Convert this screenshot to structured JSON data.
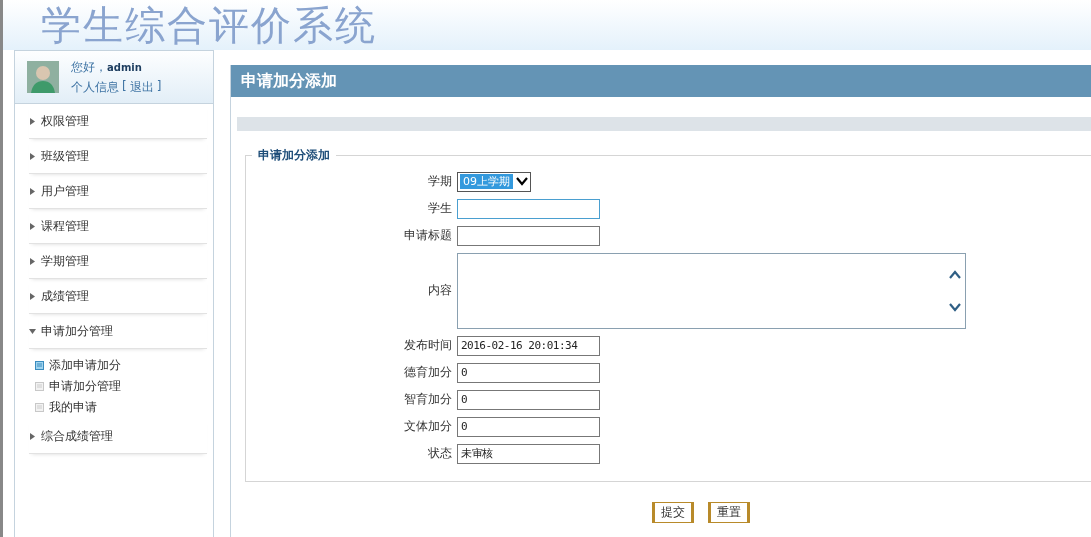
{
  "header": {
    "title": "学生综合评价系统"
  },
  "user": {
    "greeting": "您好，",
    "name": "admin",
    "profile_link": "个人信息",
    "logout_open": "[",
    "logout": "退出",
    "logout_close": "]"
  },
  "sidebar": {
    "items": [
      {
        "label": "权限管理",
        "expanded": false
      },
      {
        "label": "班级管理",
        "expanded": false
      },
      {
        "label": "用户管理",
        "expanded": false
      },
      {
        "label": "课程管理",
        "expanded": false
      },
      {
        "label": "学期管理",
        "expanded": false
      },
      {
        "label": "成绩管理",
        "expanded": false
      },
      {
        "label": "申请加分管理",
        "expanded": true,
        "children": [
          {
            "label": "添加申请加分",
            "selected": true
          },
          {
            "label": "申请加分管理",
            "selected": false
          },
          {
            "label": "我的申请",
            "selected": false
          }
        ]
      },
      {
        "label": "综合成绩管理",
        "expanded": false
      }
    ]
  },
  "page": {
    "title": "申请加分添加"
  },
  "form": {
    "legend": "申请加分添加",
    "fields": [
      {
        "label": "学期",
        "kind": "select",
        "value": "09上学期",
        "focused": false
      },
      {
        "label": "学生",
        "kind": "text",
        "focused": true
      },
      {
        "label": "申请标题",
        "kind": "text",
        "focused": false
      },
      {
        "label": "内容",
        "kind": "textarea",
        "focused": false
      },
      {
        "label": "发布时间",
        "kind": "text",
        "value": "2016-02-16 20:01:34",
        "focused": false
      },
      {
        "label": "德育加分",
        "kind": "text",
        "value": "0",
        "focused": false
      },
      {
        "label": "智育加分",
        "kind": "text",
        "value": "0",
        "focused": false
      },
      {
        "label": "文体加分",
        "kind": "text",
        "value": "0",
        "focused": false
      },
      {
        "label": "状态",
        "kind": "text",
        "value": "未审核",
        "focused": false
      }
    ]
  },
  "buttons": [
    "提交",
    "重置"
  ]
}
